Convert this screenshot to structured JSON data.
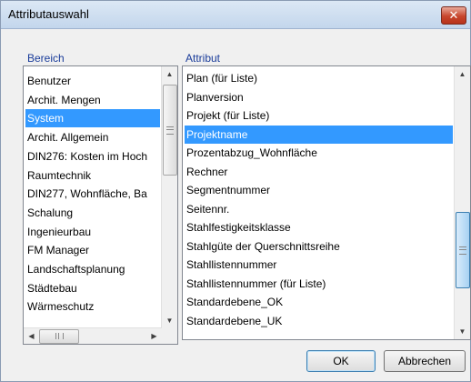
{
  "window": {
    "title": "Attributauswahl",
    "close_glyph": "✕"
  },
  "bereich": {
    "label": "Bereich",
    "items": [
      {
        "label": "Benutzer",
        "selected": false
      },
      {
        "label": "Archit. Mengen",
        "selected": false
      },
      {
        "label": "System",
        "selected": true
      },
      {
        "label": "Archit. Allgemein",
        "selected": false
      },
      {
        "label": "DIN276: Kosten im Hoch",
        "selected": false
      },
      {
        "label": "Raumtechnik",
        "selected": false
      },
      {
        "label": "DIN277, Wohnfläche, Ba",
        "selected": false
      },
      {
        "label": "Schalung",
        "selected": false
      },
      {
        "label": "Ingenieurbau",
        "selected": false
      },
      {
        "label": "FM Manager",
        "selected": false
      },
      {
        "label": "Landschaftsplanung",
        "selected": false
      },
      {
        "label": "Städtebau",
        "selected": false
      },
      {
        "label": "Wärmeschutz",
        "selected": false
      }
    ]
  },
  "attribut": {
    "label": "Attribut",
    "items": [
      {
        "label": "Plan (für Liste)",
        "selected": false
      },
      {
        "label": "Planversion",
        "selected": false
      },
      {
        "label": "Projekt (für Liste)",
        "selected": false
      },
      {
        "label": "Projektname",
        "selected": true
      },
      {
        "label": "Prozentabzug_Wohnfläche",
        "selected": false
      },
      {
        "label": "Rechner",
        "selected": false
      },
      {
        "label": "Segmentnummer",
        "selected": false
      },
      {
        "label": "Seitennr.",
        "selected": false
      },
      {
        "label": "Stahlfestigkeitsklasse",
        "selected": false
      },
      {
        "label": "Stahlgüte der Querschnittsreihe",
        "selected": false
      },
      {
        "label": "Stahllistennummer",
        "selected": false
      },
      {
        "label": "Stahllistennummer (für Liste)",
        "selected": false
      },
      {
        "label": "Standardebene_OK",
        "selected": false
      },
      {
        "label": "Standardebene_UK",
        "selected": false
      }
    ]
  },
  "buttons": {
    "ok": "OK",
    "cancel": "Abbrechen"
  },
  "icons": {
    "up": "▲",
    "down": "▼",
    "left": "◀",
    "right": "▶"
  },
  "colors": {
    "selection": "#3399ff",
    "group_label": "#1a3c9a"
  }
}
